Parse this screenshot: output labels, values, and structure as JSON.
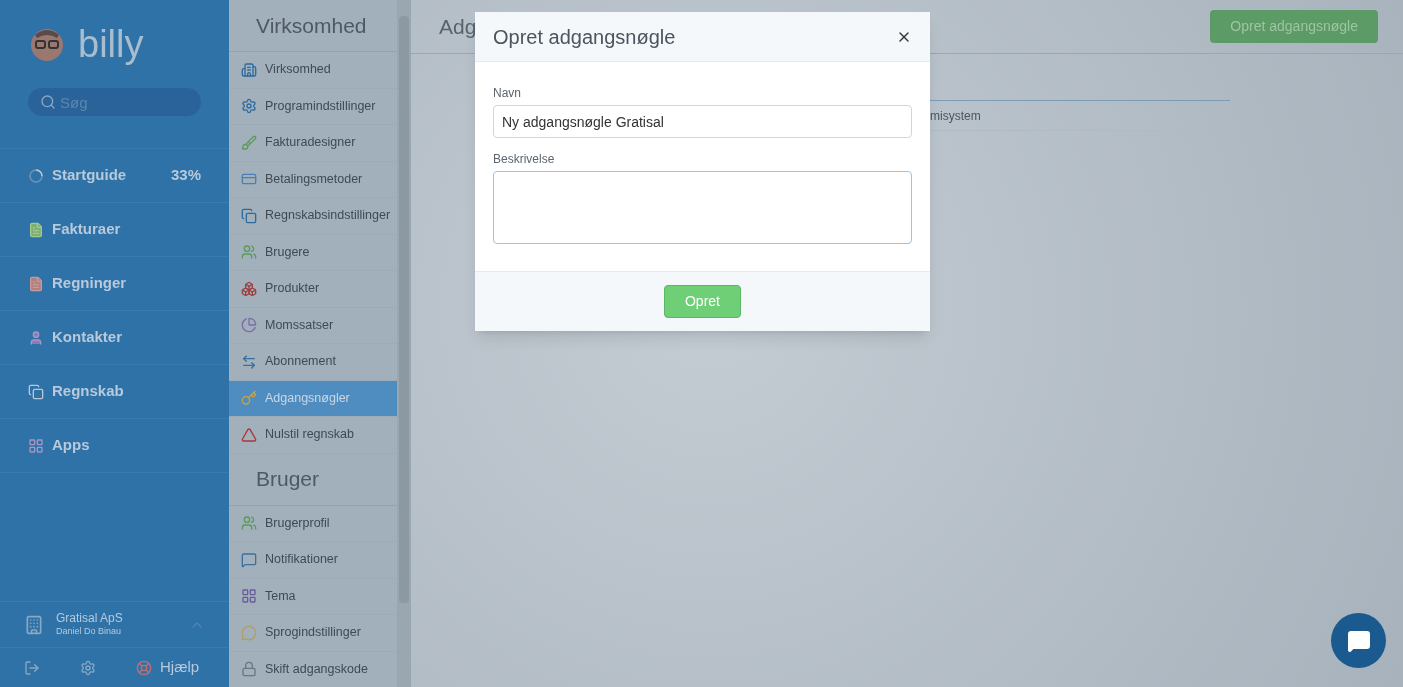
{
  "sidebar": {
    "logo": "billy",
    "search": {
      "placeholder": "Søg"
    },
    "nav": [
      {
        "kind": "progress",
        "label": "Startguide",
        "value": "33%"
      },
      {
        "kind": "invoice",
        "label": "Fakturaer"
      },
      {
        "kind": "bill",
        "label": "Regninger"
      },
      {
        "kind": "contact",
        "label": "Kontakter"
      },
      {
        "kind": "ledger",
        "label": "Regnskab"
      },
      {
        "kind": "apps",
        "label": "Apps"
      }
    ],
    "company": {
      "name": "Gratisal ApS",
      "user": "Daniel Do Binau"
    },
    "help": "Hjælp"
  },
  "settings": [
    {
      "heading": "Virksomhed",
      "items": [
        {
          "kind": "building",
          "label": "Virksomhed",
          "selected": false
        },
        {
          "kind": "gear",
          "label": "Programindstillinger",
          "selected": false
        },
        {
          "kind": "brush",
          "label": "Fakturadesigner",
          "selected": false
        },
        {
          "kind": "card",
          "label": "Betalingsmetoder",
          "selected": false
        },
        {
          "kind": "copy",
          "label": "Regnskabsindstillinger",
          "selected": false
        },
        {
          "kind": "users",
          "label": "Brugere",
          "selected": false
        },
        {
          "kind": "boxes",
          "label": "Produkter",
          "selected": false
        },
        {
          "kind": "pie",
          "label": "Momssatser",
          "selected": false
        },
        {
          "kind": "subscription",
          "label": "Abonnement",
          "selected": false
        },
        {
          "kind": "key",
          "label": "Adgangsnøgler",
          "selected": true
        },
        {
          "kind": "warning",
          "label": "Nulstil regnskab",
          "selected": false
        }
      ]
    },
    {
      "heading": "Bruger",
      "items": [
        {
          "kind": "users",
          "label": "Brugerprofil",
          "selected": false
        },
        {
          "kind": "chat",
          "label": "Notifikationer",
          "selected": false
        },
        {
          "kind": "theme",
          "label": "Tema",
          "selected": false
        },
        {
          "kind": "speech",
          "label": "Sprogindstillinger",
          "selected": false
        },
        {
          "kind": "lock",
          "label": "Skift adgangskode",
          "selected": false
        }
      ]
    }
  ],
  "main": {
    "title": "Adg",
    "action": "Opret adgangsnøgle",
    "row_text": "misystem"
  },
  "modal": {
    "title": "Opret adgangsnøgle",
    "fields": [
      {
        "kind": "input",
        "label": "Navn",
        "value": "Ny adgangsnøgle Gratisal"
      },
      {
        "kind": "textarea",
        "label": "Beskrivelse"
      }
    ],
    "submit": "Opret"
  }
}
